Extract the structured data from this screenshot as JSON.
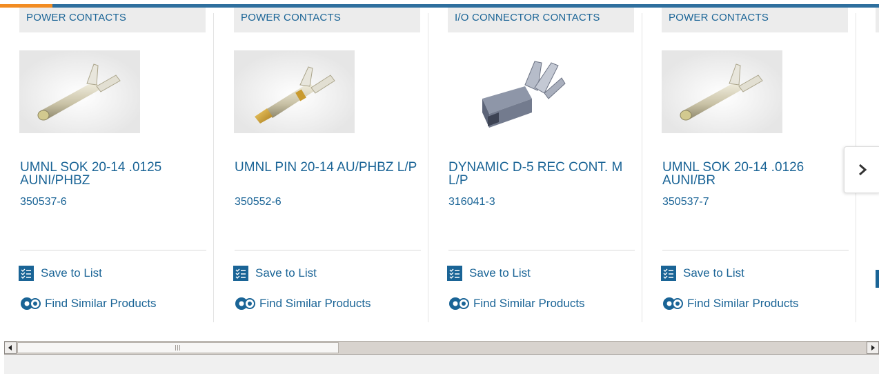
{
  "accent_colors": {
    "blue": "#2e6f9e",
    "orange": "#f28c22",
    "link": "#1a6496"
  },
  "cards": [
    {
      "category": "POWER CONTACTS",
      "name": "UMNL SOK 20-14 .0125 AUNI/PHBZ",
      "part_number": "350537-6",
      "save_label": "Save to List",
      "find_label": "Find Similar Products",
      "image": "socket-contact-image"
    },
    {
      "category": "POWER CONTACTS",
      "name": "UMNL PIN 20-14 AU/PHBZ L/P",
      "part_number": "350552-6",
      "save_label": "Save to List",
      "find_label": "Find Similar Products",
      "image": "pin-contact-image"
    },
    {
      "category": "I/O CONNECTOR CONTACTS",
      "name": "DYNAMIC D-5 REC CONT. M L/P",
      "part_number": "316041-3",
      "save_label": "Save to List",
      "find_label": "Find Similar Products",
      "image": "receptacle-contact-image"
    },
    {
      "category": "POWER CONTACTS",
      "name": "UMNL SOK 20-14 .0126 AUNI/BR",
      "part_number": "350537-7",
      "save_label": "Save to List",
      "find_label": "Find Similar Products",
      "image": "socket-contact-image"
    }
  ],
  "next_button_icon": "chevron-right-icon",
  "scrollbar_grip": "|||"
}
